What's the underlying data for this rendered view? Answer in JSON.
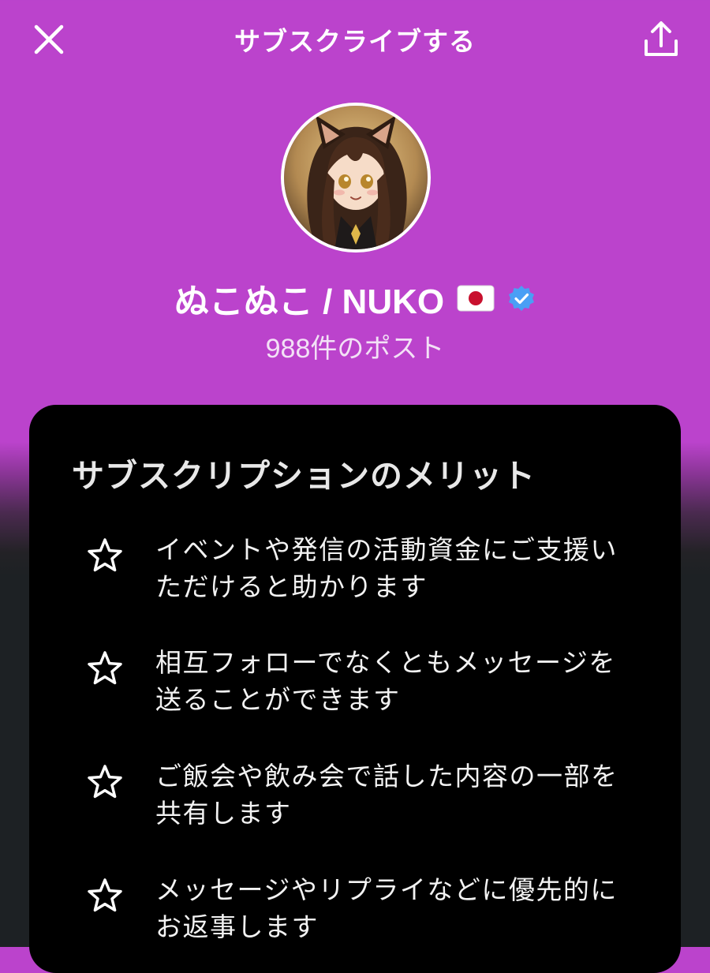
{
  "header": {
    "title": "サブスクライブする",
    "close_icon": "close-icon",
    "share_icon": "share-upload-icon"
  },
  "profile": {
    "name": "ぬこぬこ / NUKO",
    "flag_icon": "japan-flag-icon",
    "verified_icon": "verified-badge-icon",
    "post_count": "988件のポスト",
    "accent_color": "#bb43cc",
    "verified_color": "#4a9ff5"
  },
  "benefits": {
    "title": "サブスクリプションのメリット",
    "items": [
      {
        "icon": "star-outline-icon",
        "text": "イベントや発信の活動資金にご支援いただけると助かります"
      },
      {
        "icon": "star-outline-icon",
        "text": "相互フォローでなくともメッセージを送ることができます"
      },
      {
        "icon": "star-outline-icon",
        "text": "ご飯会や飲み会で話した内容の一部を共有します"
      },
      {
        "icon": "star-outline-icon",
        "text": "メッセージやリプライなどに優先的にお返事します"
      }
    ]
  }
}
